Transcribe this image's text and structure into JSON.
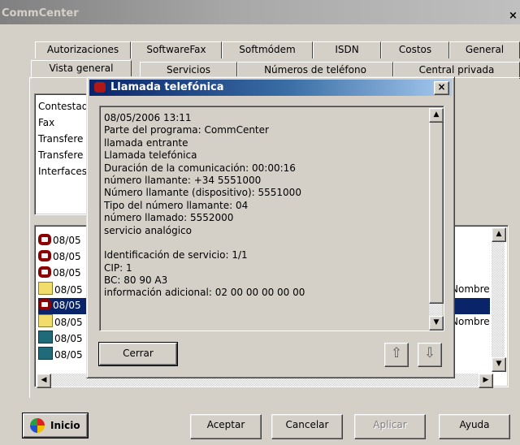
{
  "window": {
    "title": "CommCenter",
    "close_label": "×"
  },
  "tabs_row1": [
    "Autorizaciones",
    "SoftwareFax",
    "Softmódem",
    "ISDN",
    "Costos",
    "General"
  ],
  "tabs_row2": [
    "Vista general",
    "Servicios",
    "Números de teléfono",
    "Central privada"
  ],
  "upper_list": [
    "Contestad",
    "Fax",
    "Transfere",
    "Transfere",
    "Interfaces"
  ],
  "lower_list": [
    {
      "icon": "phone-icon",
      "text": "08/05",
      "selected": false
    },
    {
      "icon": "phone-icon",
      "text": "08/05",
      "selected": false
    },
    {
      "icon": "phone-icon",
      "text": "08/05",
      "selected": false
    },
    {
      "icon": "folder-icon",
      "text": "08/05",
      "selected": false
    },
    {
      "icon": "phone-icon",
      "text": "08/05",
      "selected": true
    },
    {
      "icon": "folder-icon",
      "text": "08/05",
      "selected": false
    },
    {
      "icon": "telefax-icon",
      "text": "08/05",
      "selected": false
    },
    {
      "icon": "telefax-icon",
      "text": "08/05",
      "selected": false
    }
  ],
  "lower_list_right": [
    "Nombre",
    "Nombre"
  ],
  "dialog": {
    "title": "Llamada telefónica",
    "close_label": "×",
    "lines": [
      "08/05/2006 13:11",
      "Parte del programa: CommCenter",
      "llamada entrante",
      "Llamada telefónica",
      "Duración de la comunicación: 00:00:16",
      "número llamante: +34 5551000",
      "Número llamante (dispositivo): 5551000",
      "Tipo del número llamante: 04",
      "número llamado: 5552000",
      "servicio analógico",
      "",
      "Identificación de servicio: 1/1",
      "CIP: 1",
      "BC: 80 90 A3",
      "información adicional: 02 00 00 00 00 00"
    ],
    "close_button": "Cerrar",
    "prev_arrow": "⇧",
    "next_arrow": "⇩"
  },
  "buttons": {
    "start": "Inicio",
    "accept": "Aceptar",
    "cancel": "Cancelar",
    "apply": "Aplicar",
    "help": "Ayuda"
  }
}
